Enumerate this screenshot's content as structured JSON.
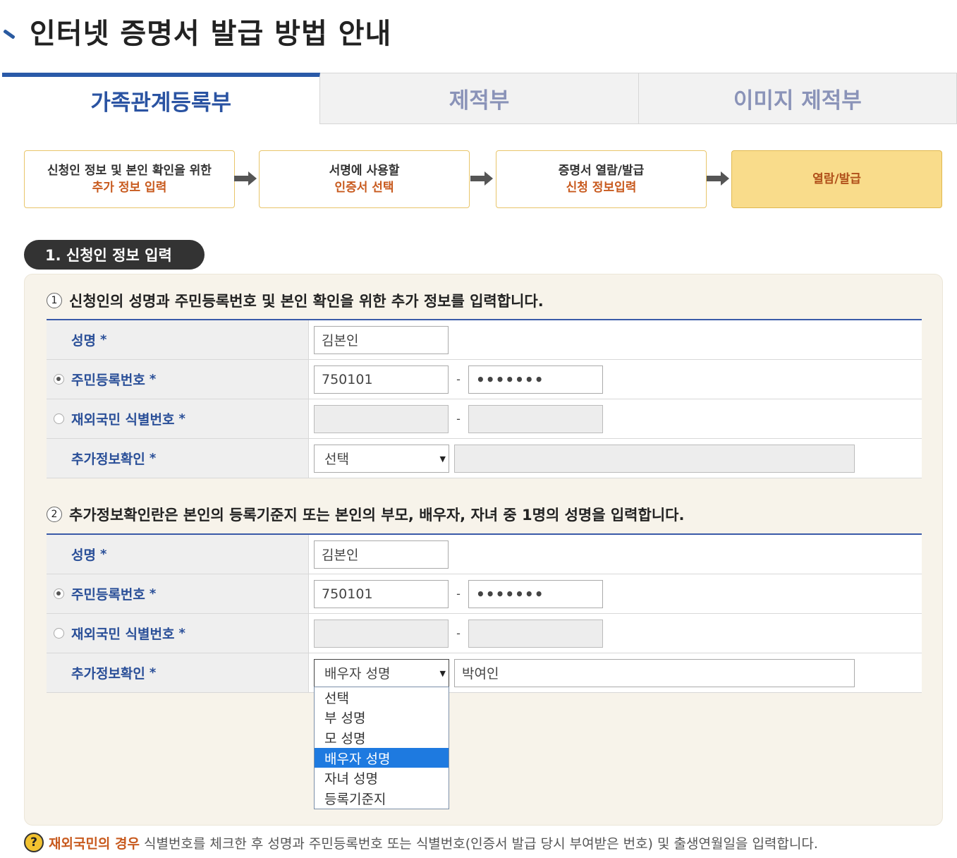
{
  "page": {
    "title": "인터넷 증명서 발급 방법 안내"
  },
  "tabs": [
    {
      "label": "가족관계등록부",
      "active": true
    },
    {
      "label": "제적부",
      "active": false
    },
    {
      "label": "이미지 제적부",
      "active": false
    }
  ],
  "steps": [
    {
      "line1": "신청인 정보 및 본인 확인을 위한",
      "line2": "추가 정보 입력"
    },
    {
      "line1": "서명에 사용할",
      "line2": "인증서 선택"
    },
    {
      "line1": "증명서 열람/발급",
      "line2": "신청 정보입력"
    },
    {
      "line1": "열람/발급",
      "line2": ""
    }
  ],
  "section": {
    "label": "1. 신청인 정보 입력"
  },
  "form1": {
    "subtitle_num": "1",
    "subtitle": "신청인의 성명과 주민등록번호 및 본인 확인을 위한 추가 정보를 입력합니다.",
    "name_label": "성명",
    "name_value": "김본인",
    "rrn_label": "주민등록번호",
    "rrn_front": "750101",
    "rrn_back": "•••••••",
    "foreign_label": "재외국민 식별번호",
    "extra_label": "추가정보확인",
    "extra_select": "선택",
    "extra_value": "",
    "star": "*",
    "dash": "-"
  },
  "form2": {
    "subtitle_num": "2",
    "subtitle": "추가정보확인란은 본인의 등록기준지 또는 본인의 부모, 배우자, 자녀 중 1명의 성명을 입력합니다.",
    "name_label": "성명",
    "name_value": "김본인",
    "rrn_label": "주민등록번호",
    "rrn_front": "750101",
    "rrn_back": "•••••••",
    "foreign_label": "재외국민 식별번호",
    "extra_label": "추가정보확인",
    "extra_select": "배우자 성명",
    "extra_value": "박여인",
    "star": "*",
    "dash": "-",
    "dropdown_options": [
      "선택",
      "부 성명",
      "모 성명",
      "배우자 성명",
      "자녀 성명",
      "등록기준지"
    ],
    "dropdown_selected_index": 3
  },
  "note": {
    "icon": "?",
    "strong": "재외국민의 경우",
    "text": "식별번호를 체크한 후 성명과 주민등록번호 또는 식별번호(인증서 발급 당시 부여받은 번호) 및 출생연월일을 입력합니다."
  }
}
